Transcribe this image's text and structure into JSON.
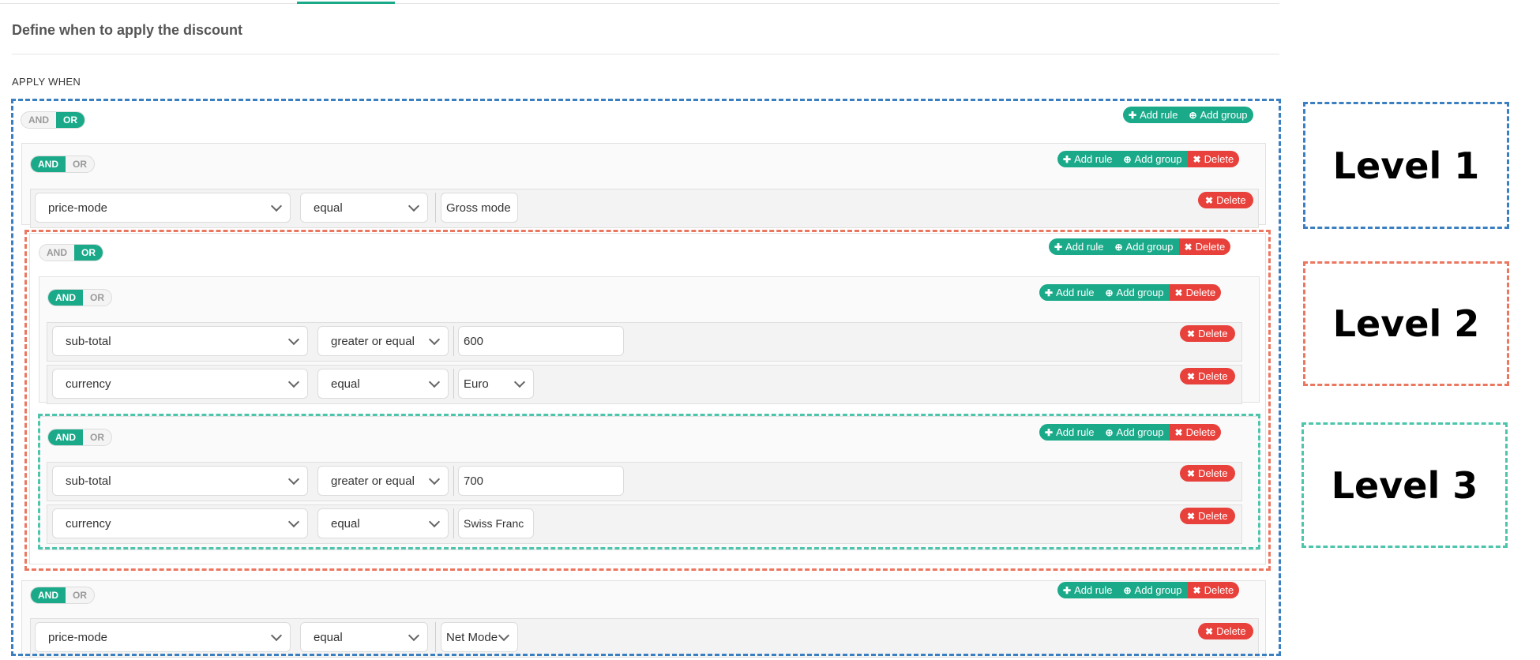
{
  "page": {
    "heading": "Define when to apply the discount",
    "apply_when": "APPLY WHEN"
  },
  "labels": {
    "and": "AND",
    "or": "OR",
    "add_rule": "Add rule",
    "add_group": "Add group",
    "delete": "Delete"
  },
  "root": {
    "combinator": "OR"
  },
  "group_a": {
    "combinator": "AND",
    "rule": {
      "field": "price-mode",
      "operator": "equal",
      "value": "Gross mode"
    }
  },
  "group_b": {
    "combinator": "OR"
  },
  "group_b1": {
    "combinator": "AND",
    "rule1": {
      "field": "sub-total",
      "operator": "greater or equal",
      "value": "600"
    },
    "rule2": {
      "field": "currency",
      "operator": "equal",
      "value": "Euro"
    }
  },
  "group_b2": {
    "combinator": "AND",
    "rule1": {
      "field": "sub-total",
      "operator": "greater or equal",
      "value": "700"
    },
    "rule2": {
      "field": "currency",
      "operator": "equal",
      "value": "Swiss Franc"
    }
  },
  "group_c": {
    "combinator": "AND",
    "rule": {
      "field": "price-mode",
      "operator": "equal",
      "value": "Net Mode"
    }
  },
  "levels": {
    "level1": "Level 1",
    "level2": "Level 2",
    "level3": "Level 3"
  },
  "colors": {
    "accent": "#1aaa8a",
    "danger": "#e8403a",
    "level1": "#3a7fc1",
    "level2": "#ec7760",
    "level3": "#4dc5ad"
  }
}
